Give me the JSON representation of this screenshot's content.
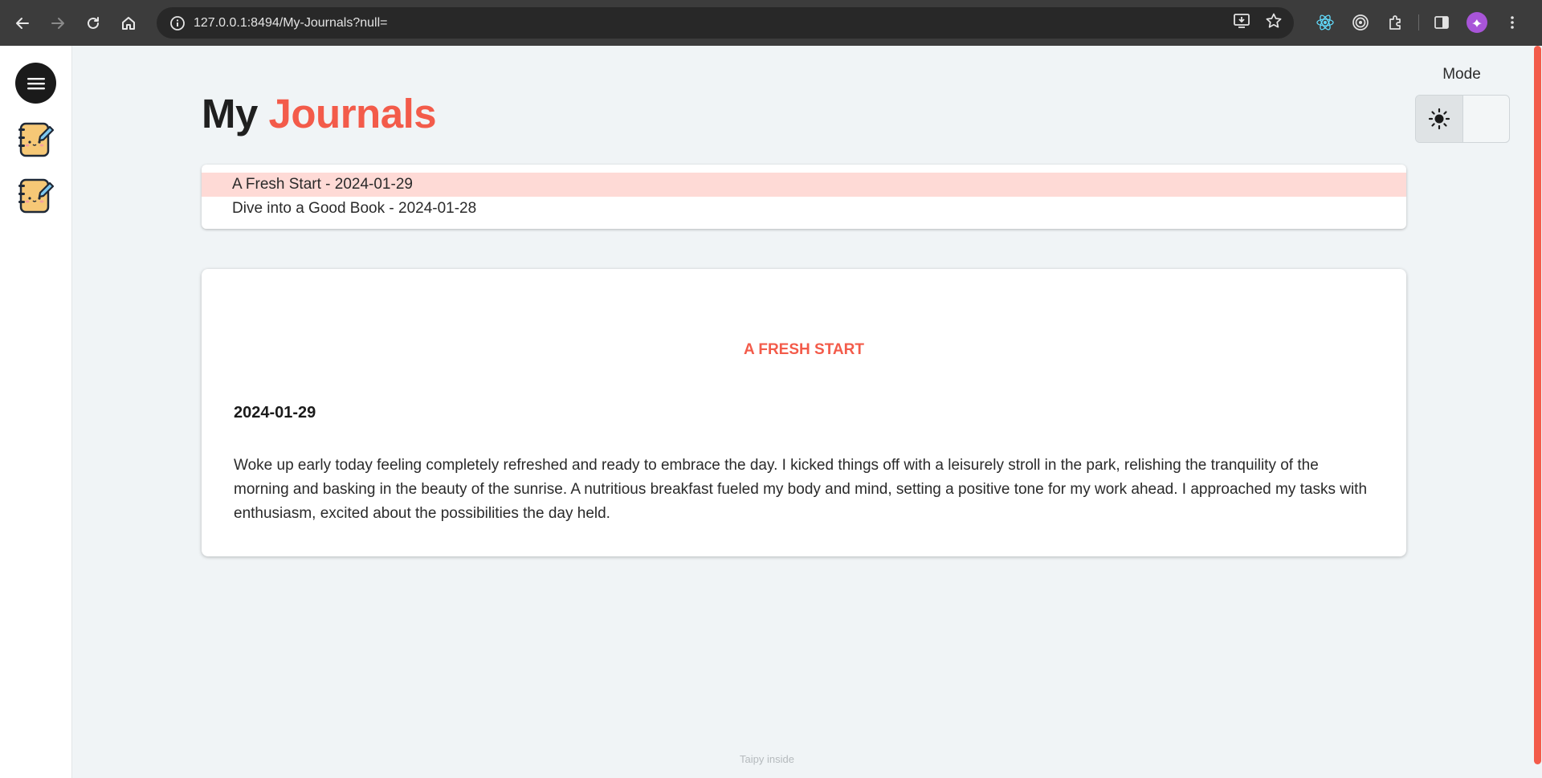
{
  "browser": {
    "url": "127.0.0.1:8494/My-Journals?null="
  },
  "header": {
    "title_prefix": "My",
    "title_accent": "Journals"
  },
  "mode": {
    "label": "Mode",
    "selected": "light"
  },
  "entries": [
    {
      "label": "A Fresh Start - 2024-01-29",
      "selected": true
    },
    {
      "label": "Dive into a Good Book - 2024-01-28",
      "selected": false
    }
  ],
  "entry": {
    "title": "A FRESH START",
    "date": "2024-01-29",
    "body": "Woke up early today feeling completely refreshed and ready to embrace the day. I kicked things off with a leisurely stroll in the park, relishing the tranquility of the morning and basking in the beauty of the sunrise. A nutritious breakfast fueled my body and mind, setting a positive tone for my work ahead. I approached my tasks with enthusiasm, excited about the possibilities the day held."
  },
  "footer": {
    "text": "Taipy inside"
  },
  "colors": {
    "accent": "#f35b4a",
    "selected_row": "#fedad6",
    "background": "#f0f4f6"
  }
}
